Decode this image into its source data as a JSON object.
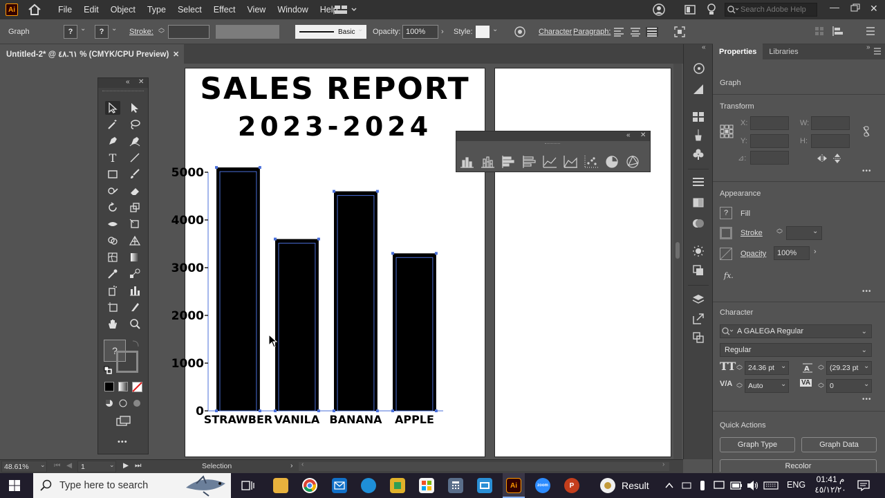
{
  "app": {
    "logo_text": "Ai",
    "menu": [
      "File",
      "Edit",
      "Object",
      "Type",
      "Select",
      "Effect",
      "View",
      "Window",
      "Help"
    ],
    "search_placeholder": "Search Adobe Help"
  },
  "control_bar": {
    "selection_type": "Graph",
    "stroke_label": "Stroke:",
    "brush_label": "Basic",
    "opacity_label": "Opacity:",
    "opacity_value": "100%",
    "style_label": "Style:",
    "character_label": "Character",
    "paragraph_label": "Paragraph:"
  },
  "document_tab": {
    "title": "Untitled-2* @ ٤٨.٦١ % (CMYK/CPU Preview)",
    "close": "✕"
  },
  "artboard": {
    "title_line1": "SALES REPORT",
    "title_line2": "2023-2024"
  },
  "chart_data": {
    "type": "bar",
    "title": "SALES REPORT 2023-2024",
    "categories": [
      "STRAWBERRY",
      "VANILA",
      "BANANA",
      "APPLE"
    ],
    "category_labels_visible": [
      "STRAWBER",
      "VANILA",
      "BANANA",
      "APPLE"
    ],
    "values": [
      5100,
      3600,
      4600,
      3300
    ],
    "y_ticks": [
      "0",
      "1000",
      "2000",
      "3000",
      "4000",
      "5000"
    ],
    "ylim": [
      0,
      5000
    ],
    "bar_color": "#000000",
    "selection_color": "#4a6fd9"
  },
  "tools_panel": {
    "collapse": "«",
    "close": "✕",
    "fill_placeholder": "?",
    "more": "•••"
  },
  "graph_panel": {
    "collapse": "«",
    "close": "✕",
    "graph_types": [
      "column-graph-icon",
      "stacked-column-graph-icon",
      "bar-graph-icon",
      "stacked-bar-graph-icon",
      "line-graph-icon",
      "area-graph-icon",
      "scatter-graph-icon",
      "pie-graph-icon",
      "radar-graph-icon"
    ]
  },
  "properties": {
    "tabs": [
      "Properties",
      "Libraries"
    ],
    "object_type": "Graph",
    "transform_label": "Transform",
    "x_label": "X:",
    "y_label": "Y:",
    "w_label": "W:",
    "h_label": "H:",
    "angle_label": "⊿:",
    "appearance_label": "Appearance",
    "fill_label": "Fill",
    "stroke_label": "Stroke",
    "opacity_label": "Opacity",
    "opacity_value": "100%",
    "fx_label": "fx.",
    "character_label": "Character",
    "font_family": "A GALEGA Regular",
    "font_style": "Regular",
    "font_size": "24.36 pt",
    "leading": "(29.23 pt",
    "kerning": "Auto",
    "tracking": "0",
    "quick_actions_label": "Quick Actions",
    "graph_type_button": "Graph Type",
    "graph_data_button": "Graph Data",
    "recolor_button": "Recolor",
    "more": "•••"
  },
  "status_bar": {
    "zoom": "48.61%",
    "artboard_number": "1",
    "tool_name": "Selection"
  },
  "taskbar": {
    "search_placeholder": "Type here to search",
    "result_label": "Result",
    "language": "ENG",
    "time": "01:41 م",
    "date": "٤٥/١٢/٢٠"
  }
}
